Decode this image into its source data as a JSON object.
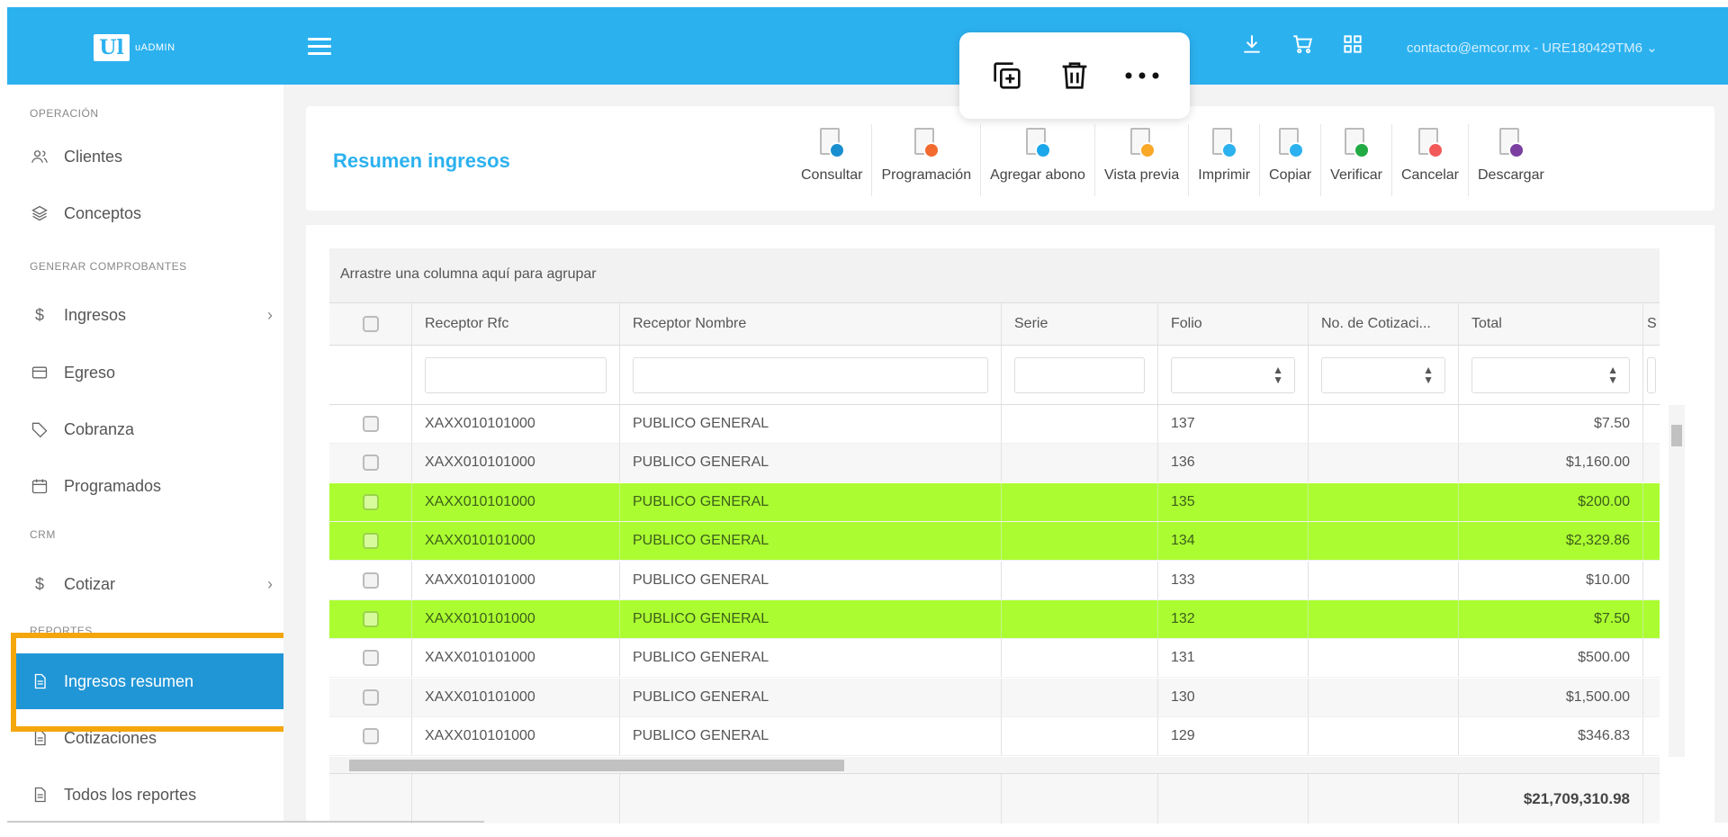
{
  "app": {
    "logo_mark": "Ul",
    "logo_text": "uADMIN"
  },
  "header": {
    "user": "contacto@emcor.mx - URE180429TM6 ⌄"
  },
  "sidebar": {
    "sections": {
      "operacion": "OPERACIÓN",
      "generar": "GENERAR COMPROBANTES",
      "crm": "CRM",
      "reportes": "REPORTES"
    },
    "items": [
      {
        "label": "Clientes",
        "icon": "users-icon"
      },
      {
        "label": "Conceptos",
        "icon": "layers-icon"
      },
      {
        "label": "Ingresos",
        "icon": "dollar-icon"
      },
      {
        "label": "Egreso",
        "icon": "card-icon"
      },
      {
        "label": "Cobranza",
        "icon": "tag-icon"
      },
      {
        "label": "Programados",
        "icon": "calendar-icon"
      },
      {
        "label": "Cotizar",
        "icon": "dollar-icon"
      },
      {
        "label": "Ingresos resumen",
        "icon": "document-icon"
      },
      {
        "label": "Cotizaciones",
        "icon": "document-icon"
      },
      {
        "label": "Todos los reportes",
        "icon": "document-icon"
      }
    ]
  },
  "page": {
    "title": "Resumen ingresos"
  },
  "toolbar": [
    {
      "label": "Consultar",
      "color": "#1a8fd0",
      "glyph": "⚲"
    },
    {
      "label": "Programación",
      "color": "#f26a2e",
      "glyph": "▭"
    },
    {
      "label": "Agregar abono",
      "color": "#1ba7ea",
      "glyph": "+"
    },
    {
      "label": "Vista previa",
      "color": "#f9a82a",
      "glyph": "◉"
    },
    {
      "label": "Imprimir",
      "color": "#2cb1ef",
      "glyph": "▤"
    },
    {
      "label": "Copiar",
      "color": "#2cb1ef",
      "glyph": "❐"
    },
    {
      "label": "Verificar",
      "color": "#22aa44",
      "glyph": "✓"
    },
    {
      "label": "Cancelar",
      "color": "#f25a5a",
      "glyph": "✕"
    },
    {
      "label": "Descargar",
      "color": "#7a3fa0",
      "glyph": "⇓"
    }
  ],
  "grid": {
    "group_hint": "Arrastre una columna aquí para agrupar",
    "columns": [
      "Receptor Rfc",
      "Receptor Nombre",
      "Serie",
      "Folio",
      "No. de Cotizaci...",
      "Total",
      "S"
    ],
    "rows": [
      {
        "rfc": "XAXX010101000",
        "nombre": "PUBLICO GENERAL",
        "serie": "",
        "folio": "137",
        "cotizacion": "",
        "total": "$7.50",
        "highlight": false
      },
      {
        "rfc": "XAXX010101000",
        "nombre": "PUBLICO GENERAL",
        "serie": "",
        "folio": "136",
        "cotizacion": "",
        "total": "$1,160.00",
        "highlight": false
      },
      {
        "rfc": "XAXX010101000",
        "nombre": "PUBLICO GENERAL",
        "serie": "",
        "folio": "135",
        "cotizacion": "",
        "total": "$200.00",
        "highlight": true
      },
      {
        "rfc": "XAXX010101000",
        "nombre": "PUBLICO GENERAL",
        "serie": "",
        "folio": "134",
        "cotizacion": "",
        "total": "$2,329.86",
        "highlight": true
      },
      {
        "rfc": "XAXX010101000",
        "nombre": "PUBLICO GENERAL",
        "serie": "",
        "folio": "133",
        "cotizacion": "",
        "total": "$10.00",
        "highlight": false
      },
      {
        "rfc": "XAXX010101000",
        "nombre": "PUBLICO GENERAL",
        "serie": "",
        "folio": "132",
        "cotizacion": "",
        "total": "$7.50",
        "highlight": true
      },
      {
        "rfc": "XAXX010101000",
        "nombre": "PUBLICO GENERAL",
        "serie": "",
        "folio": "131",
        "cotizacion": "",
        "total": "$500.00",
        "highlight": false
      },
      {
        "rfc": "XAXX010101000",
        "nombre": "PUBLICO GENERAL",
        "serie": "",
        "folio": "130",
        "cotizacion": "",
        "total": "$1,500.00",
        "highlight": false
      },
      {
        "rfc": "XAXX010101000",
        "nombre": "PUBLICO GENERAL",
        "serie": "",
        "folio": "129",
        "cotizacion": "",
        "total": "$346.83",
        "highlight": false
      }
    ],
    "grand_total": "$21,709,310.98"
  },
  "colors": {
    "header": "#2cb1ef",
    "active_nav": "#2196d6",
    "row_highlight": "#abfd32",
    "annotation_box": "#f4a60d"
  }
}
